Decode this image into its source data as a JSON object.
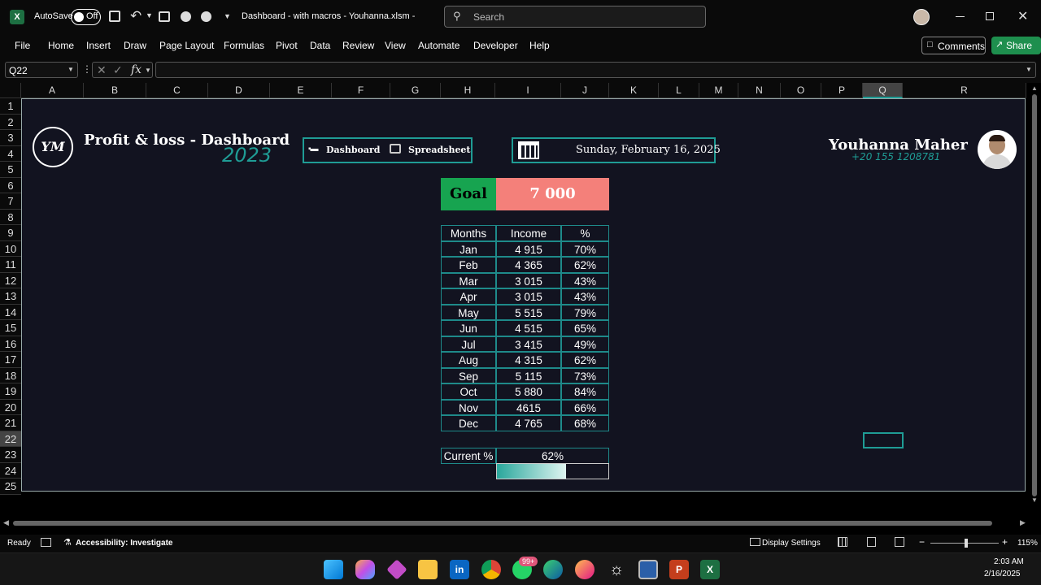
{
  "titlebar": {
    "app_icon": "excel-icon",
    "autosave_label": "AutoSave",
    "autosave_state": "Off",
    "doc_title": "Dashboard - with macros - Youhanna.xlsm  -",
    "search_placeholder": "Search"
  },
  "ribbon": {
    "tabs": [
      "File",
      "Home",
      "Insert",
      "Draw",
      "Page Layout",
      "Formulas",
      "Pivot",
      "Data",
      "Review",
      "View",
      "Automate",
      "Developer",
      "Help"
    ],
    "comments_label": "Comments",
    "share_label": "Share"
  },
  "formula_bar": {
    "name_box": "Q22",
    "fx": "fx",
    "content": ""
  },
  "columns": [
    "A",
    "B",
    "C",
    "D",
    "E",
    "F",
    "G",
    "H",
    "I",
    "J",
    "K",
    "L",
    "M",
    "N",
    "O",
    "P",
    "Q",
    "R"
  ],
  "rows": [
    "1",
    "2",
    "3",
    "4",
    "5",
    "6",
    "7",
    "8",
    "9",
    "10",
    "11",
    "12",
    "13",
    "14",
    "15",
    "16",
    "17",
    "18",
    "19",
    "20",
    "21",
    "22",
    "23",
    "24",
    "25"
  ],
  "dashboard": {
    "logo_text": "YM",
    "title": "Profit & loss - Dashboard",
    "year": "2023",
    "nav_dashboard": "Dashboard",
    "nav_spreadsheet": "Spreadsheet",
    "date": "Sunday, February 16, 2025",
    "author_name": "Youhanna Maher",
    "author_phone": "+20 155 1208781",
    "goal_label": "Goal",
    "goal_value": "7 000",
    "table_headers": [
      "Months",
      "Income",
      "%"
    ],
    "table_rows": [
      [
        "Jan",
        "4 915",
        "70%"
      ],
      [
        "Feb",
        "4 365",
        "62%"
      ],
      [
        "Mar",
        "3 015",
        "43%"
      ],
      [
        "Apr",
        "3 015",
        "43%"
      ],
      [
        "May",
        "5 515",
        "79%"
      ],
      [
        "Jun",
        "4 515",
        "65%"
      ],
      [
        "Jul",
        "3 415",
        "49%"
      ],
      [
        "Aug",
        "4 315",
        "62%"
      ],
      [
        "Sep",
        "5 115",
        "73%"
      ],
      [
        "Oct",
        "5 880",
        "84%"
      ],
      [
        "Nov",
        "4615",
        "66%"
      ],
      [
        "Dec",
        "4 765",
        "68%"
      ]
    ],
    "current_label": "Current %",
    "current_value": "62%",
    "progress_fraction": 0.62
  },
  "statusbar": {
    "ready": "Ready",
    "accessibility": "Accessibility: Investigate",
    "display_settings": "Display Settings",
    "zoom": "115%"
  },
  "taskbar": {
    "badge": "99+",
    "time": "2:03 AM",
    "date": "2/16/2025"
  },
  "colors": {
    "teal": "#1f9c95",
    "goal_green": "#17a450",
    "goal_red": "#f4807a",
    "canvas": "#121320"
  }
}
